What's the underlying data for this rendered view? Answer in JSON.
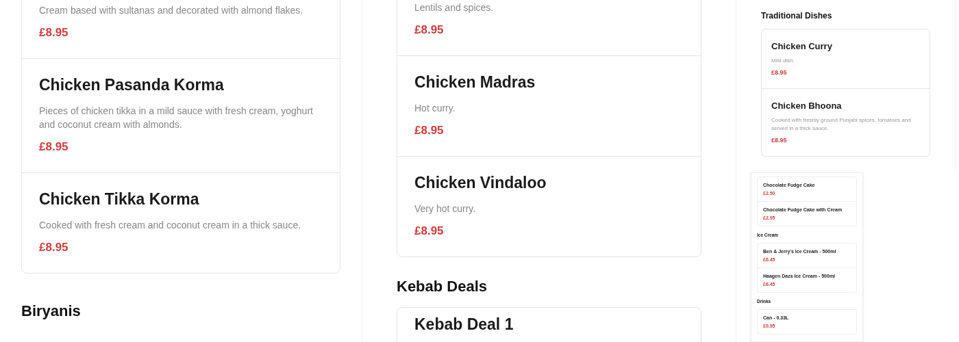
{
  "panels": [
    {
      "kind": "full",
      "sections": [
        {
          "items": [
            {
              "description": "Cream based with sultanas and decorated with almond flakes.",
              "price": "£8.95"
            },
            {
              "name": "Chicken Pasanda Korma",
              "description": "Pieces of chicken tikka in a mild sauce with fresh cream, yoghurt and coconut cream with almonds.",
              "price": "£8.95"
            },
            {
              "name": "Chicken Tikka Korma",
              "description": "Cooked with fresh cream and coconut cream in a thick sauce.",
              "price": "£8.95"
            }
          ]
        },
        {
          "heading": "Biryanis"
        }
      ]
    },
    {
      "kind": "full",
      "sections": [
        {
          "items": [
            {
              "description": "Lentils and spices.",
              "price": "£8.95"
            },
            {
              "name": "Chicken Madras",
              "description": "Hot curry.",
              "price": "£8.95"
            },
            {
              "name": "Chicken Vindaloo",
              "description": "Very hot curry.",
              "price": "£8.95"
            }
          ]
        },
        {
          "heading": "Kebab Deals",
          "items": [
            {
              "name": "Kebab Deal 1"
            }
          ]
        }
      ]
    },
    {
      "kind": "compact",
      "sections": [
        {
          "heading": "Traditional Dishes",
          "items": [
            {
              "name": "Chicken Curry",
              "description": "Mild dish.",
              "price": "£8.95"
            },
            {
              "name": "Chicken Bhoona",
              "description": "Cooked with freshly ground Punjabi spices, tomatoes and served in a thick sauce.",
              "price": "£8.95"
            }
          ]
        }
      ]
    },
    {
      "kind": "mini",
      "sections": [
        {
          "items": [
            {
              "name": "Chocolate Fudge Cake",
              "price": "£2.50"
            },
            {
              "name": "Chocolate Fudge Cake with Cream",
              "price": "£2.95"
            }
          ]
        },
        {
          "heading": "Ice Cream",
          "items": [
            {
              "name": "Ben & Jerry's Ice Cream - 500ml",
              "price": "£6.45"
            },
            {
              "name": "Haagen Dazs Ice Cream - 500ml",
              "price": "£6.45"
            }
          ]
        },
        {
          "heading": "Drinks",
          "items": [
            {
              "name": "Can - 0.33L",
              "price": "£0.95"
            }
          ]
        }
      ]
    }
  ]
}
